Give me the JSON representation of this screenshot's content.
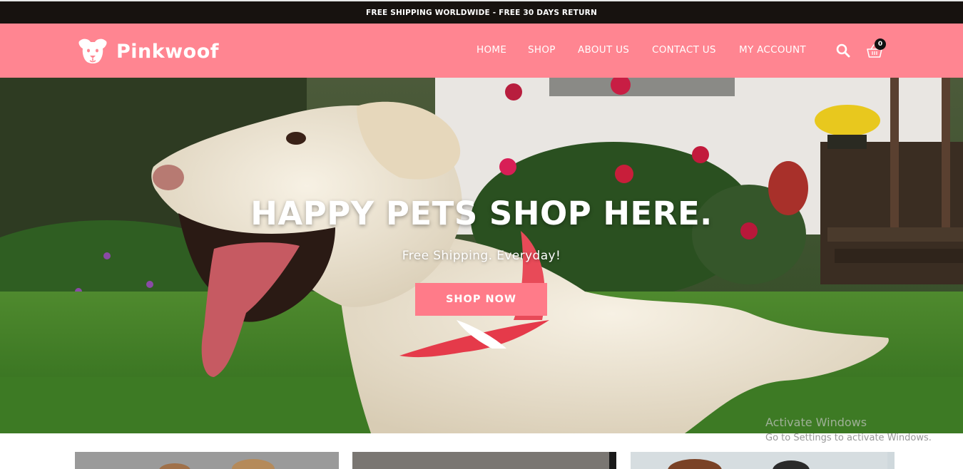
{
  "announcement": "FREE SHIPPING WORLDWIDE - FREE 30 DAYS RETURN",
  "brand": {
    "name": "Pinkwoof",
    "logo_icon": "dog-face-icon"
  },
  "nav": {
    "items": [
      {
        "label": "HOME"
      },
      {
        "label": "SHOP"
      },
      {
        "label": "ABOUT US"
      },
      {
        "label": "CONTACT US"
      },
      {
        "label": "MY ACCOUNT"
      }
    ],
    "search_icon": "search-icon",
    "cart_icon": "basket-icon",
    "cart_count": "0"
  },
  "hero": {
    "title": "HAPPY PETS SHOP HERE.",
    "subtitle": "Free Shipping. Everyday!",
    "cta_label": "SHOP NOW",
    "image": "white labrador dog lying on grass with red bandana"
  },
  "watermark": {
    "line1": "Activate Windows",
    "line2": "Go to Settings to activate Windows."
  },
  "colors": {
    "header_bg": "#ff8591",
    "topbar_bg": "#17120f",
    "cta_bg": "#ff7b89",
    "text_on_brand": "#ffffff"
  }
}
